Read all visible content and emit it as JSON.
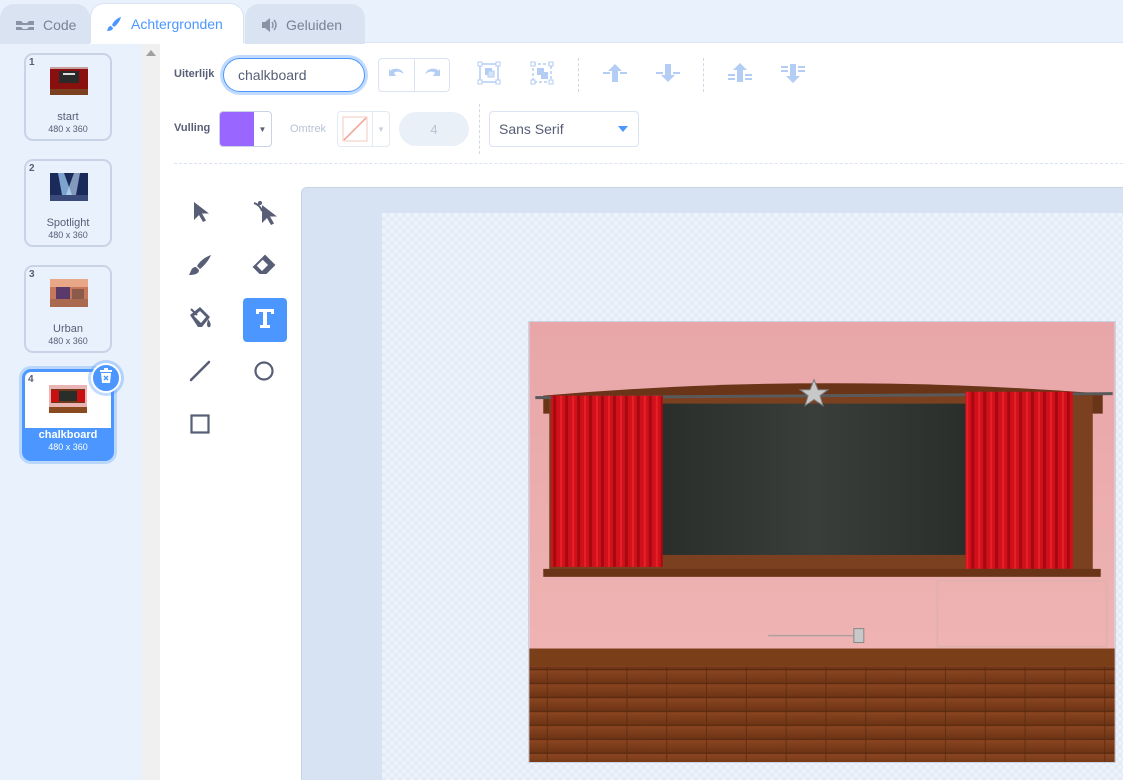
{
  "tabs": [
    {
      "label": "Code",
      "icon": "code-icon"
    },
    {
      "label": "Achtergronden",
      "icon": "brush-icon"
    },
    {
      "label": "Geluiden",
      "icon": "speaker-icon"
    }
  ],
  "costumes": [
    {
      "num": "1",
      "name": "start",
      "size": "480 x 360"
    },
    {
      "num": "2",
      "name": "Spotlight",
      "size": "480 x 360"
    },
    {
      "num": "3",
      "name": "Urban",
      "size": "480 x 360"
    },
    {
      "num": "4",
      "name": "chalkboard",
      "size": "480 x 360"
    }
  ],
  "toolbar": {
    "costume_label": "Uiterlijk",
    "costume_name": "chalkboard",
    "fill_label": "Vulling",
    "fill_color": "#9966ff",
    "outline_label": "Omtrek",
    "outline_width": "4",
    "font": "Sans Serif"
  },
  "colors": {
    "accent": "#4c97ff",
    "panel": "#e9f1fc",
    "text": "#575e75"
  },
  "tools": [
    "select-tool",
    "reshape-tool",
    "brush-tool",
    "eraser-tool",
    "fill-tool",
    "text-tool",
    "line-tool",
    "circle-tool",
    "rectangle-tool"
  ],
  "active_tool": "text-tool"
}
